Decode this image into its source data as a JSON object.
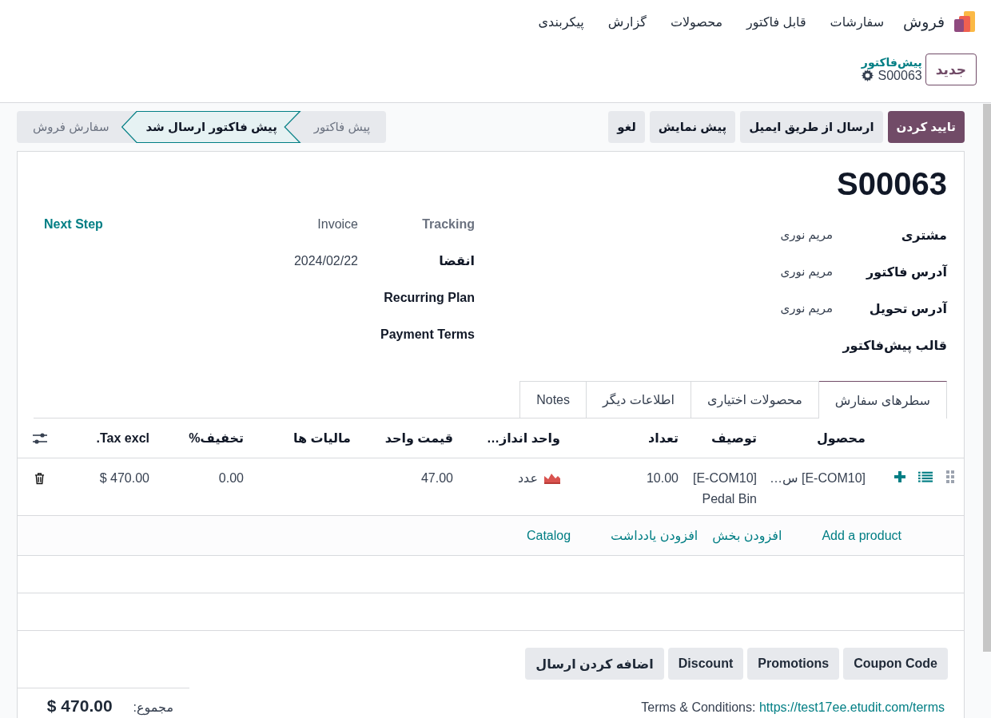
{
  "app": {
    "name": "فروش"
  },
  "menu": [
    "سفارشات",
    "قابل فاکتور",
    "محصولات",
    "گزارش",
    "پیکربندی"
  ],
  "new_button": "جدید",
  "breadcrumb": {
    "parent": "پیش‌فاکتور",
    "current": "S00063"
  },
  "actions": [
    {
      "label": "تایید کردن",
      "primary": true
    },
    {
      "label": "ارسال از طریق ایمیل",
      "primary": false
    },
    {
      "label": "پیش نمایش",
      "primary": false
    },
    {
      "label": "لغو",
      "primary": false
    }
  ],
  "status_steps": [
    {
      "label": "پیش فاکتور",
      "selected": false
    },
    {
      "label": "پیش فاکتور ارسال شد",
      "selected": true
    },
    {
      "label": "سفارش فروش",
      "selected": false
    }
  ],
  "record": {
    "title": "S00063"
  },
  "fields_right": [
    {
      "label": "مشتری",
      "value": "مریم نوری"
    },
    {
      "label": "آدرس فاکتور",
      "value": "مریم نوری"
    },
    {
      "label": "آدرس تحویل",
      "value": "مریم نوری"
    },
    {
      "label": "قالب پیش‌فاکتور"
    }
  ],
  "fields_left": [
    {
      "label": "Tracking",
      "value": "Invoice",
      "kind": "heading"
    },
    {
      "label": "انقضا",
      "value": "2024/02/22",
      "kind": "field"
    },
    {
      "label": "Recurring Plan",
      "kind": "field"
    },
    {
      "label": "Payment Terms",
      "kind": "field"
    }
  ],
  "next_step": "Next Step",
  "tabs": [
    {
      "label": "سطرهای سفارش",
      "selected": true
    },
    {
      "label": "محصولات اختیاری",
      "selected": false
    },
    {
      "label": "اطلاعات دیگر",
      "selected": false
    },
    {
      "label": "Notes",
      "selected": false
    }
  ],
  "table": {
    "columns": [
      "محصول",
      "توصیف",
      "تعداد",
      "واحد انداز…",
      "قیمت واحد",
      "مالیات ها",
      "تخفیف%",
      "Tax excl."
    ],
    "rows": [
      {
        "product": "[E-COM10] س…",
        "description": "[E-COM10] Pedal Bin",
        "quantity": "10.00",
        "uom": "عدد",
        "unit_price": "47.00",
        "discount": "0.00",
        "subtotal": "$ 470.00"
      }
    ],
    "add_links": [
      "Add a product",
      "افزودن بخش",
      "افزودن یادداشت",
      "Catalog"
    ]
  },
  "footer_buttons": [
    "Coupon Code",
    "Promotions",
    "Discount",
    "اضافه کردن ارسال"
  ],
  "total": {
    "label": "مجموع:",
    "value": "$ 470.00"
  },
  "terms": {
    "label": "Terms & Conditions:",
    "link": "https://test17ee.etudit.com/terms"
  }
}
